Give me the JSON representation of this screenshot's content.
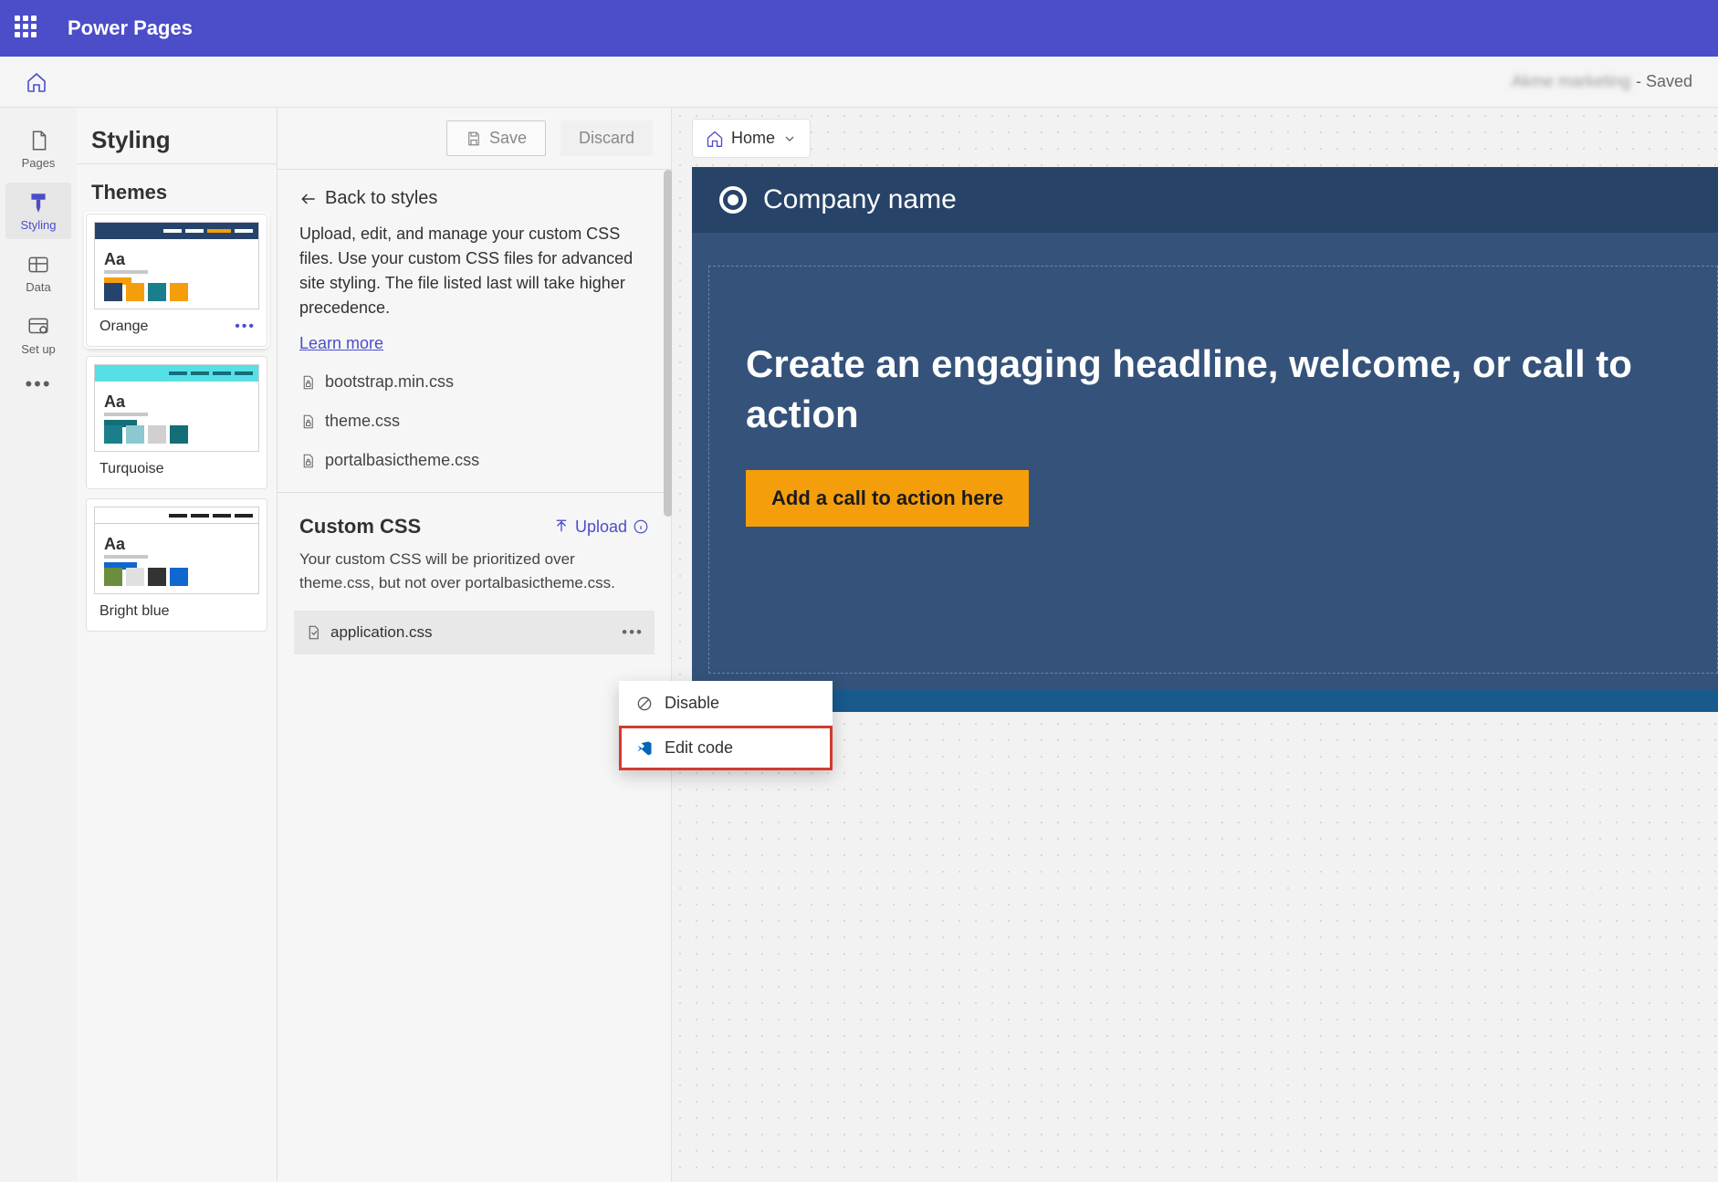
{
  "app": {
    "title": "Power Pages"
  },
  "cmdbar": {
    "site_name": "Akme marketing",
    "saved": " - Saved",
    "home_label": "Home"
  },
  "rail": {
    "items": [
      {
        "label": "Pages"
      },
      {
        "label": "Styling"
      },
      {
        "label": "Data"
      },
      {
        "label": "Set up"
      }
    ]
  },
  "styling": {
    "title": "Styling",
    "themes_heading": "Themes",
    "save": "Save",
    "discard": "Discard",
    "themes": [
      {
        "name": "Orange"
      },
      {
        "name": "Turquoise"
      },
      {
        "name": "Bright blue"
      }
    ]
  },
  "detail": {
    "back": "Back to styles",
    "description": "Upload, edit, and manage your custom CSS files. Use your custom CSS files for advanced site styling. The file listed last will take higher precedence.",
    "learn_more": "Learn more",
    "files": [
      "bootstrap.min.css",
      "theme.css",
      "portalbasictheme.css"
    ],
    "custom_title": "Custom CSS",
    "upload": "Upload",
    "custom_desc": "Your custom CSS will be prioritized over theme.css, but not over portalbasictheme.css.",
    "custom_file": "application.css"
  },
  "preview": {
    "crumb": "Home",
    "company": "Company name",
    "headline": "Create an engaging headline, welcome, or call to action",
    "cta": "Add a call to action here"
  },
  "popup": {
    "disable": "Disable",
    "edit_code": "Edit code"
  },
  "colors": {
    "orange_top": "#26436b",
    "orange_sw": [
      "#26436b",
      "#f59e0b",
      "#1b7e8c",
      "#f59e0b"
    ],
    "orange_accent": "#f59e0b",
    "turq_top": "#58e0e8",
    "turq_sw": [
      "#1b7e8c",
      "#8bc8cf",
      "#d0d0d0",
      "#146d77"
    ],
    "blue_top": "#222",
    "blue_sw": [
      "#6b8e3e",
      "#e0e0e0",
      "#333",
      "#1067cf"
    ]
  }
}
